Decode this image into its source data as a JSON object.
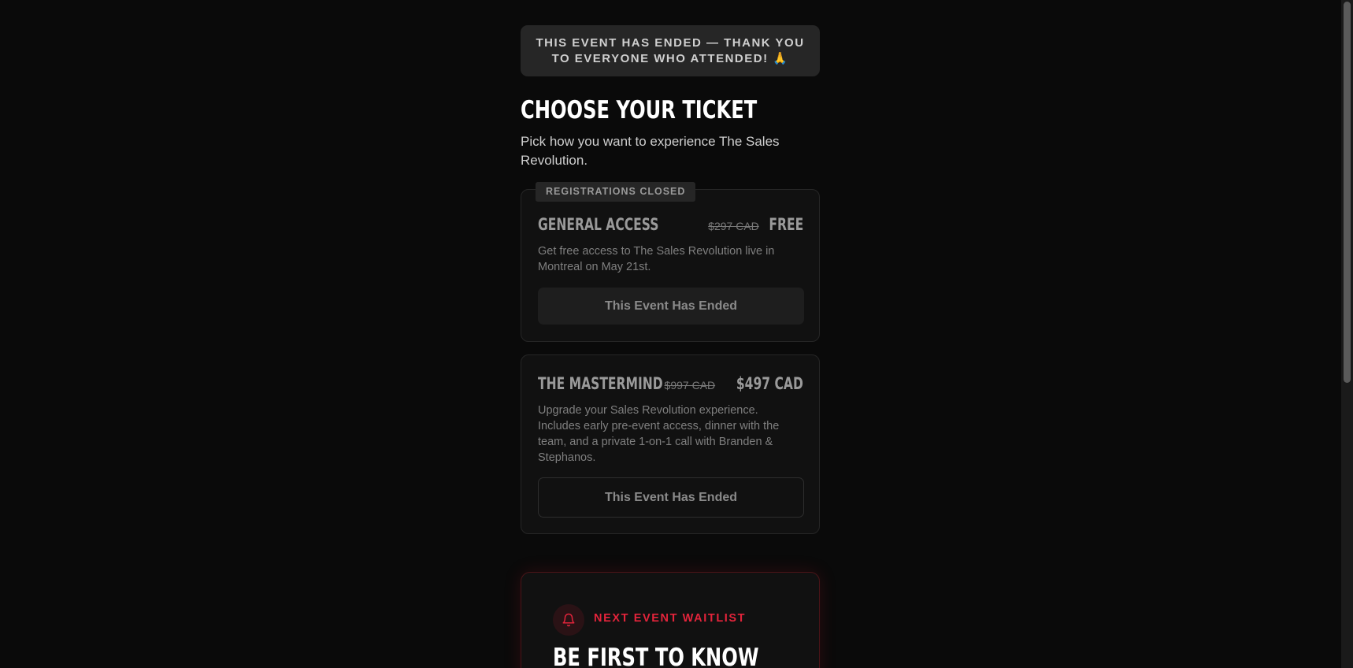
{
  "banner": {
    "text": "This event has ended — thank you to everyone who attended! 🙏"
  },
  "header": {
    "title": "CHOOSE YOUR TICKET",
    "subtitle": "Pick how you want to experience The Sales Revolution."
  },
  "tickets": [
    {
      "badge": "REGISTRATIONS CLOSED",
      "name": "GENERAL ACCESS",
      "old_price": "$297 CAD",
      "price": "FREE",
      "description": "Get free access to The Sales Revolution live in Montreal on May 21st.",
      "button_label": "This Event Has Ended"
    },
    {
      "name": "THE MASTERMIND",
      "old_price": "$997 CAD",
      "price": "$497 CAD",
      "description": "Upgrade your Sales Revolution experience. Includes early pre-event access, dinner with the team, and a private 1-on-1 call with Branden & Stephanos.",
      "button_label": "This Event Has Ended"
    }
  ],
  "waitlist": {
    "icon": "bell-icon",
    "label": "NEXT EVENT WAITLIST",
    "title": "BE FIRST TO KNOW"
  },
  "colors": {
    "background": "#0a0a0a",
    "accent_red": "#e3243b",
    "card": "#111111"
  }
}
